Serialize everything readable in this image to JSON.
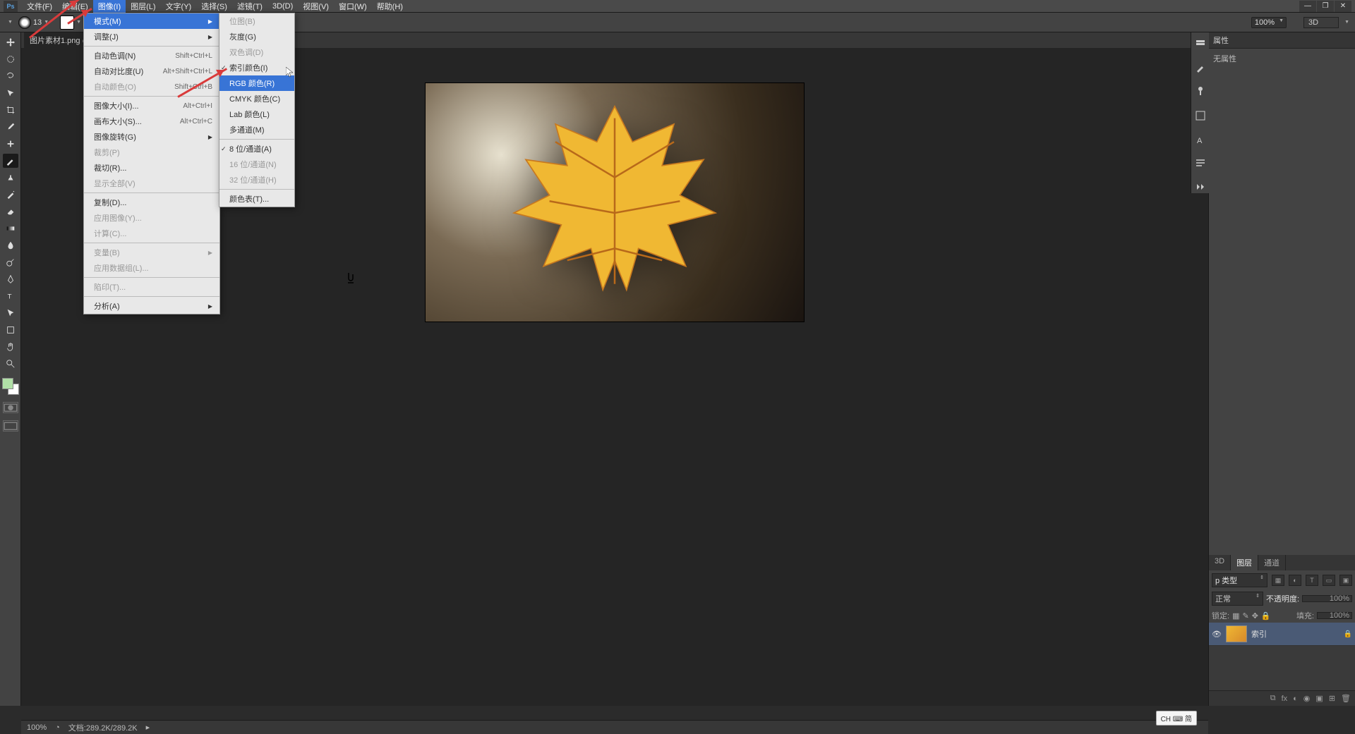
{
  "menubar": {
    "items": [
      "文件(F)",
      "编辑(E)",
      "图像(I)",
      "图层(L)",
      "文字(Y)",
      "选择(S)",
      "滤镜(T)",
      "3D(D)",
      "视图(V)",
      "窗口(W)",
      "帮助(H)"
    ]
  },
  "options_bar": {
    "brush_size": "13",
    "zoom": "100%",
    "mode_3d": "3D"
  },
  "doc_tab": {
    "label": "图片素材1.png @"
  },
  "image_menu": {
    "items": [
      {
        "label": "模式(M)",
        "shortcut": "",
        "submenu": true,
        "hi": true
      },
      {
        "label": "调整(J)",
        "shortcut": "",
        "submenu": true
      },
      {
        "sep": true
      },
      {
        "label": "自动色调(N)",
        "shortcut": "Shift+Ctrl+L"
      },
      {
        "label": "自动对比度(U)",
        "shortcut": "Alt+Shift+Ctrl+L"
      },
      {
        "label": "自动颜色(O)",
        "shortcut": "Shift+Ctrl+B",
        "dis": true
      },
      {
        "sep": true
      },
      {
        "label": "图像大小(I)...",
        "shortcut": "Alt+Ctrl+I"
      },
      {
        "label": "画布大小(S)...",
        "shortcut": "Alt+Ctrl+C"
      },
      {
        "label": "图像旋转(G)",
        "shortcut": "",
        "submenu": true
      },
      {
        "label": "裁剪(P)",
        "dis": true
      },
      {
        "label": "裁切(R)..."
      },
      {
        "label": "显示全部(V)",
        "dis": true
      },
      {
        "sep": true
      },
      {
        "label": "复制(D)..."
      },
      {
        "label": "应用图像(Y)...",
        "dis": true
      },
      {
        "label": "计算(C)...",
        "dis": true
      },
      {
        "sep": true
      },
      {
        "label": "变量(B)",
        "submenu": true,
        "dis": true
      },
      {
        "label": "应用数据组(L)...",
        "dis": true
      },
      {
        "sep": true
      },
      {
        "label": "陷印(T)...",
        "dis": true
      },
      {
        "sep": true
      },
      {
        "label": "分析(A)",
        "submenu": true
      }
    ]
  },
  "mode_submenu": {
    "items": [
      {
        "label": "位图(B)",
        "dis": true
      },
      {
        "label": "灰度(G)"
      },
      {
        "label": "双色调(D)",
        "dis": true
      },
      {
        "label": "索引颜色(I)",
        "check": true
      },
      {
        "label": "RGB 颜色(R)",
        "hi": true
      },
      {
        "label": "CMYK 颜色(C)"
      },
      {
        "label": "Lab 颜色(L)"
      },
      {
        "label": "多通道(M)"
      },
      {
        "sep": true
      },
      {
        "label": "8 位/通道(A)",
        "check": true
      },
      {
        "label": "16 位/通道(N)",
        "dis": true
      },
      {
        "label": "32 位/通道(H)",
        "dis": true
      },
      {
        "sep": true
      },
      {
        "label": "颜色表(T)..."
      }
    ]
  },
  "properties_panel": {
    "title": "属性",
    "body": "无属性"
  },
  "layers_panel": {
    "tabs": [
      "3D",
      "图层",
      "通道"
    ],
    "kind_label": "p 类型",
    "blend_mode": "正常",
    "opacity_label": "不透明度:",
    "opacity_value": "100%",
    "lock_label": "锁定:",
    "fill_label": "填充:",
    "fill_value": "100%",
    "layer_name": "索引"
  },
  "statusbar": {
    "zoom": "100%",
    "doc_info": "文档:289.2K/289.2K"
  },
  "ime": "CH ⌨ 简"
}
